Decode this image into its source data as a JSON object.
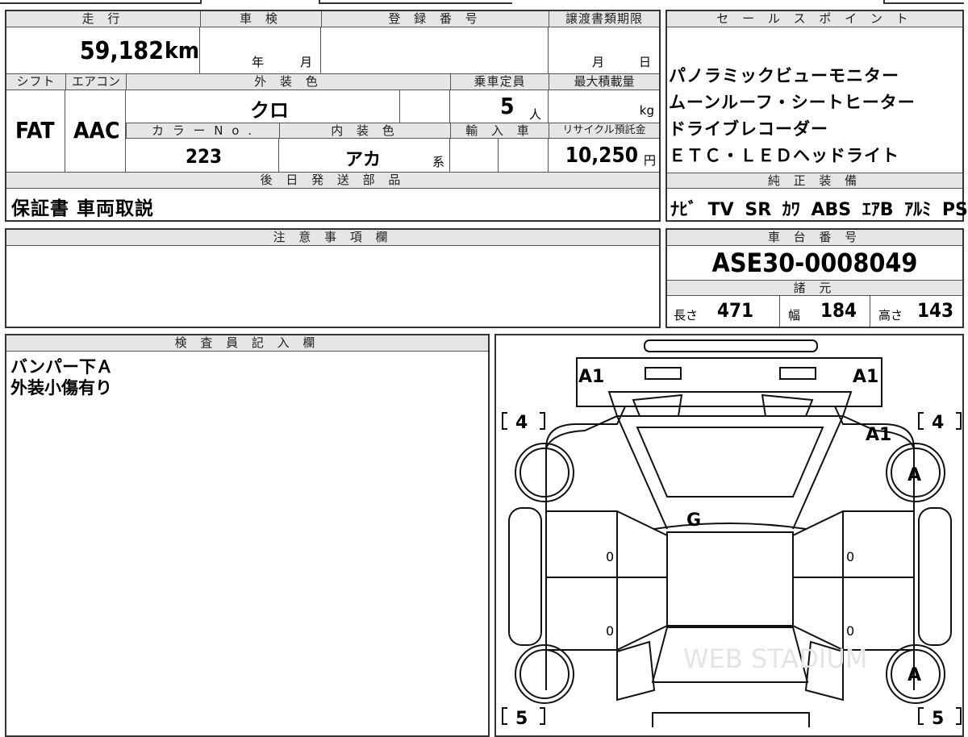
{
  "top": {
    "mileage_label": "走 行",
    "mileage_value": "59,182",
    "mileage_unit": "km",
    "inspection_label": "車 検",
    "inspection_year": "年",
    "inspection_month": "月",
    "registration_label": "登 録 番 号",
    "transfer_label": "譲渡書類期限",
    "transfer_month": "月",
    "transfer_day": "日",
    "shift_label": "シフト",
    "shift_value": "FAT",
    "ac_label": "エアコン",
    "ac_value": "AAC",
    "exterior_label": "外 装 色",
    "exterior_value": "クロ",
    "capacity_label": "乗車定員",
    "capacity_value": "5",
    "capacity_unit": "人",
    "maxload_label": "最大積載量",
    "maxload_unit": "kg",
    "colorno_label": "カ ラ ー N o .",
    "colorno_value": "223",
    "interior_label": "内 装 色",
    "interior_value": "アカ",
    "interior_unit": "系",
    "import_label": "輸 入 車",
    "recycle_label": "リサイクル預託金",
    "recycle_value": "10,250",
    "recycle_unit": "円",
    "later_label": "後 日 発 送 部 品",
    "later_value": "保証書 車両取説"
  },
  "sales": {
    "label": "セ ー ル ス ポ イ ン ト",
    "lines": [
      "パノラミックビューモニター",
      "ムーンルーフ・シートヒーター",
      "ドライブレコーダー",
      "ＥＴＣ・ＬＥＤヘッドライト"
    ]
  },
  "equipment": {
    "label": "純 正 装 備",
    "value": "ﾅﾋﾞ TV SR ｶﾜ ABS ｴｱB ｱﾙﾐ PS PW"
  },
  "notes": {
    "label": "注 意 事 項 欄"
  },
  "chassis": {
    "label": "車 台 番 号",
    "value": "ASE30-0008049",
    "specs_label": "諸 元",
    "length_label": "長さ",
    "length_value": "471",
    "width_label": "幅",
    "width_value": "184",
    "height_label": "高さ",
    "height_value": "143"
  },
  "inspector": {
    "label": "検 査 員 記 入 欄",
    "line1": "バンパー下Ａ",
    "line2": "外装小傷有り"
  },
  "diagram": {
    "front_left": "A1",
    "front_right": "A1",
    "fender_right": "A1",
    "tire_fl": "4",
    "tire_fr": "4",
    "tire_rl": "5",
    "tire_rr": "5",
    "wheel_fr": "A",
    "wheel_rr": "A",
    "windshield": "G",
    "door_fl": "0",
    "door_rl": "0",
    "door_fr": "0",
    "door_rr": "0",
    "watermark": "WEB STADIUM"
  }
}
